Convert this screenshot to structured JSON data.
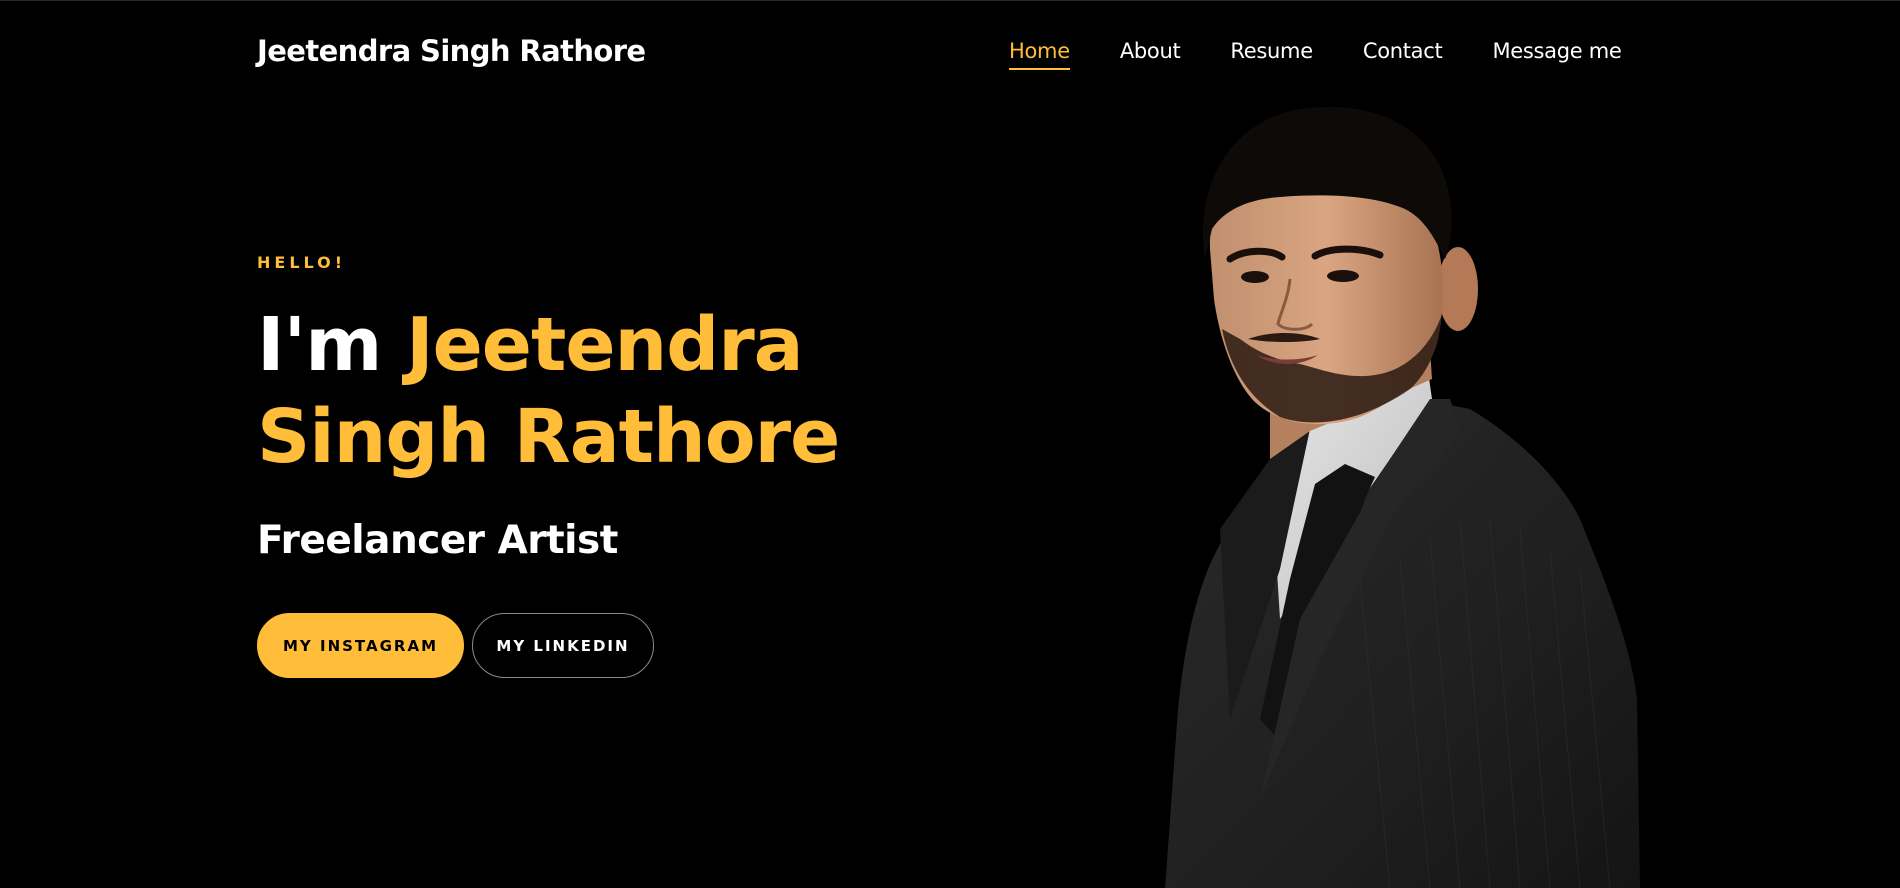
{
  "brand": {
    "name": "Jeetendra Singh Rathore"
  },
  "nav": {
    "items": [
      {
        "label": "Home",
        "active": true
      },
      {
        "label": "About",
        "active": false
      },
      {
        "label": "Resume",
        "active": false
      },
      {
        "label": "Contact",
        "active": false
      },
      {
        "label": "Message me",
        "active": false
      }
    ]
  },
  "hero": {
    "greeting": "HELLO!",
    "title_prefix": "I'm ",
    "title_name_line1": "Jeetendra",
    "title_name_line2": "Singh Rathore",
    "subtitle": "Freelancer Artist",
    "buttons": {
      "instagram": "MY INSTAGRAM",
      "linkedin": "MY LINKEDIN"
    }
  },
  "colors": {
    "background": "#000000",
    "accent": "#ffbd39",
    "text": "#ffffff"
  }
}
